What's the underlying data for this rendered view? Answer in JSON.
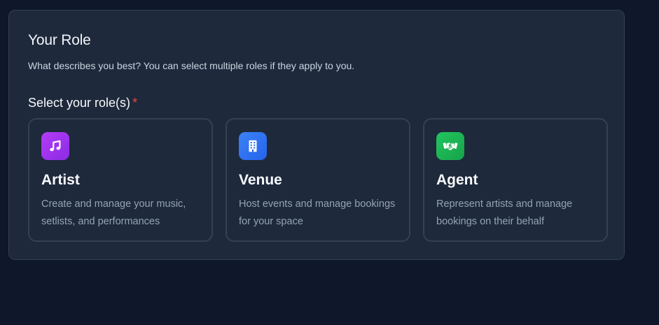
{
  "colors": {
    "page_background": "#0f172a",
    "panel_background": "#1e293b",
    "border": "#334155",
    "required": "#ef4444",
    "artist_icon": "#a033f0",
    "venue_icon": "#2f6bf0",
    "agent_icon": "#16b851"
  },
  "section": {
    "title": "Your Role",
    "description": "What describes you best? You can select multiple roles if they apply to you."
  },
  "field": {
    "label": "Select your role(s)",
    "required_mark": "*"
  },
  "roles": [
    {
      "icon": "music-note-icon",
      "name": "Artist",
      "description": "Create and manage your music, setlists, and performances"
    },
    {
      "icon": "building-icon",
      "name": "Venue",
      "description": "Host events and manage bookings for your space"
    },
    {
      "icon": "handshake-icon",
      "name": "Agent",
      "description": "Represent artists and manage bookings on their behalf"
    }
  ]
}
